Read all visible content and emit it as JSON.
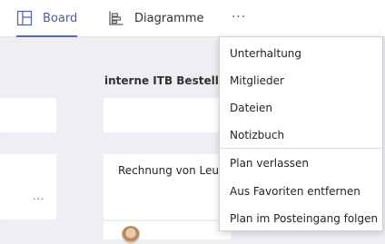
{
  "tabs": {
    "board_label": "Board",
    "diagram_label": "Diagramme",
    "more_label": "···"
  },
  "board": {
    "bucket_title": "interne ITB Bestellun",
    "task_title": "Rechnung von Leuc",
    "card_more": "..."
  },
  "menu": {
    "items": [
      "Unterhaltung",
      "Mitglieder",
      "Dateien",
      "Notizbuch",
      "Plan verlassen",
      "Aus Favoriten entfernen",
      "Plan im Posteingang folgen"
    ]
  },
  "colors": {
    "accent": "#5764b8",
    "background": "#edeff3"
  }
}
